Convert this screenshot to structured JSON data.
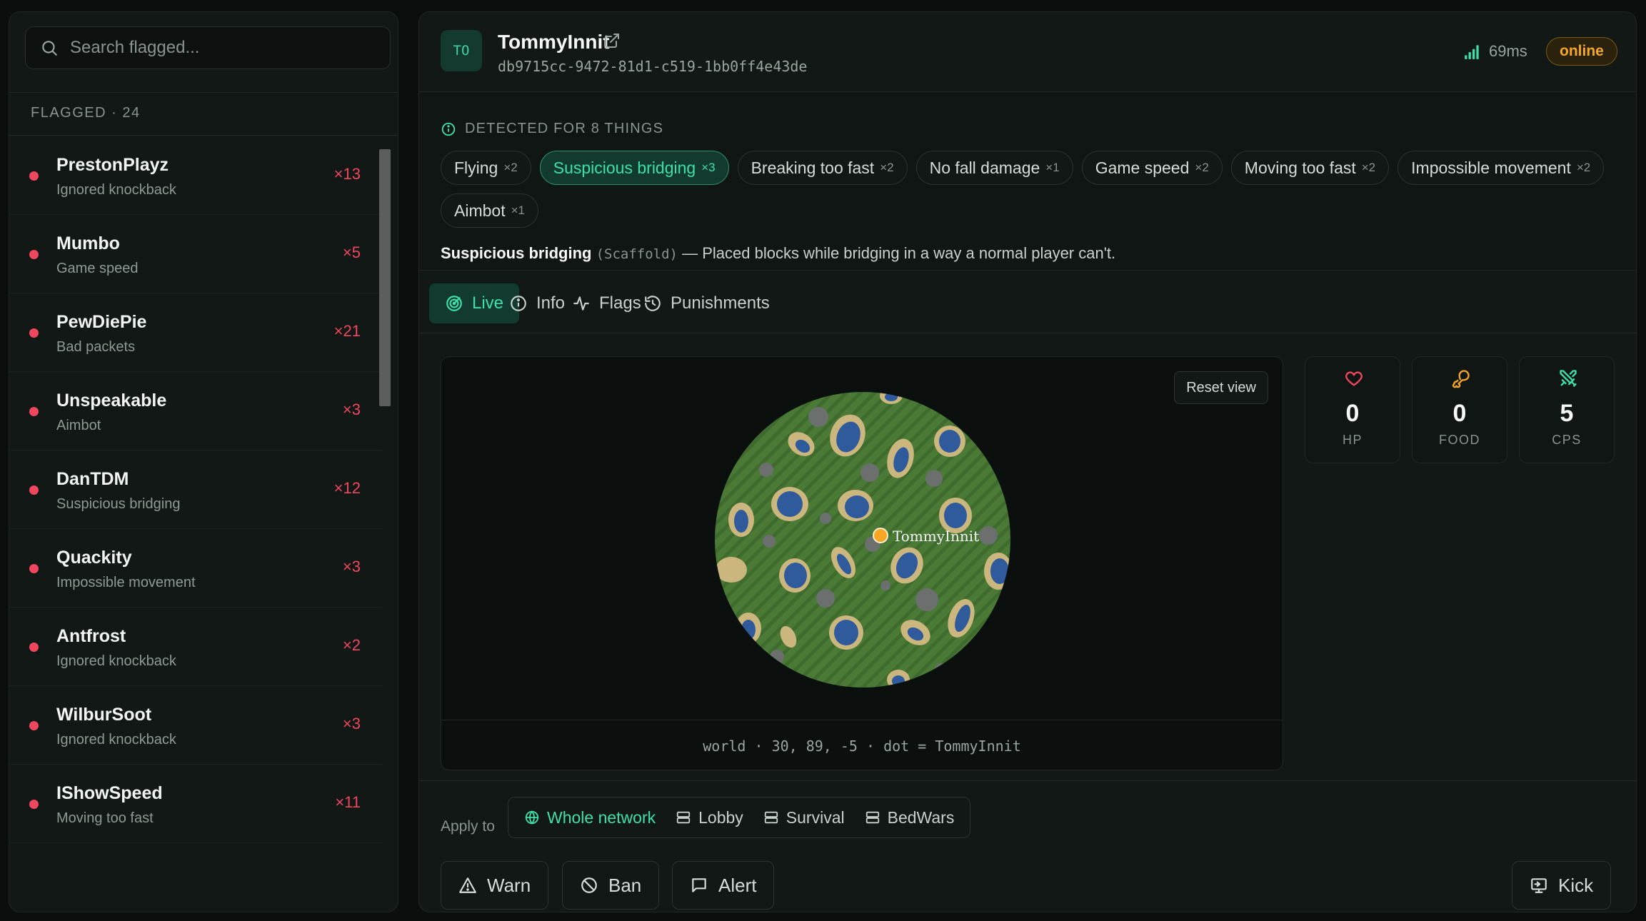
{
  "sidebar": {
    "search_placeholder": "Search flagged...",
    "flagged_label": "FLAGGED · 24",
    "items": [
      {
        "name": "PrestonPlayz",
        "reason": "Ignored knockback",
        "count": "×13"
      },
      {
        "name": "Mumbo",
        "reason": "Game speed",
        "count": "×5"
      },
      {
        "name": "PewDiePie",
        "reason": "Bad packets",
        "count": "×21"
      },
      {
        "name": "Unspeakable",
        "reason": "Aimbot",
        "count": "×3"
      },
      {
        "name": "DanTDM",
        "reason": "Suspicious bridging",
        "count": "×12"
      },
      {
        "name": "Quackity",
        "reason": "Impossible movement",
        "count": "×3"
      },
      {
        "name": "Antfrost",
        "reason": "Ignored knockback",
        "count": "×2"
      },
      {
        "name": "WilburSoot",
        "reason": "Ignored knockback",
        "count": "×3"
      },
      {
        "name": "IShowSpeed",
        "reason": "Moving too fast",
        "count": "×11"
      }
    ]
  },
  "player": {
    "initials": "TO",
    "name": "TommyInnit",
    "uuid": "db9715cc-9472-81d1-c519-1bb0ff4e43de",
    "ping": "69ms",
    "status": "online"
  },
  "detections": {
    "title": "DETECTED FOR 8 THINGS",
    "chips": [
      {
        "label": "Flying",
        "count": "×2"
      },
      {
        "label": "Suspicious bridging",
        "count": "×3"
      },
      {
        "label": "Breaking too fast",
        "count": "×2"
      },
      {
        "label": "No fall damage",
        "count": "×1"
      },
      {
        "label": "Game speed",
        "count": "×2"
      },
      {
        "label": "Moving too fast",
        "count": "×2"
      },
      {
        "label": "Impossible movement",
        "count": "×2"
      },
      {
        "label": "Aimbot",
        "count": "×1"
      }
    ],
    "selected": {
      "name": "Suspicious bridging",
      "code": "(Scaffold)",
      "description": "— Placed blocks while bridging in a way a normal player can't."
    }
  },
  "tabs": {
    "live": "Live",
    "info": "Info",
    "flags": "Flags",
    "punishments": "Punishments"
  },
  "map": {
    "reset_label": "Reset view",
    "player_label": "TommyInnit",
    "footer": "world · 30, 89, -5 · dot = TommyInnit"
  },
  "stats": {
    "hp": {
      "value": "0",
      "label": "HP"
    },
    "food": {
      "value": "0",
      "label": "FOOD"
    },
    "cps": {
      "value": "5",
      "label": "CPS"
    }
  },
  "apply": {
    "label": "Apply to",
    "options": [
      "Whole network",
      "Lobby",
      "Survival",
      "BedWars"
    ]
  },
  "actions": {
    "warn": "Warn",
    "ban": "Ban",
    "alert": "Alert",
    "kick": "Kick"
  },
  "colors": {
    "accent": "#3ee0aa",
    "danger": "#f0475f",
    "warning": "#f5a623",
    "heart": "#f0475f",
    "food": "#f5a623",
    "cps": "#3ee0aa"
  }
}
